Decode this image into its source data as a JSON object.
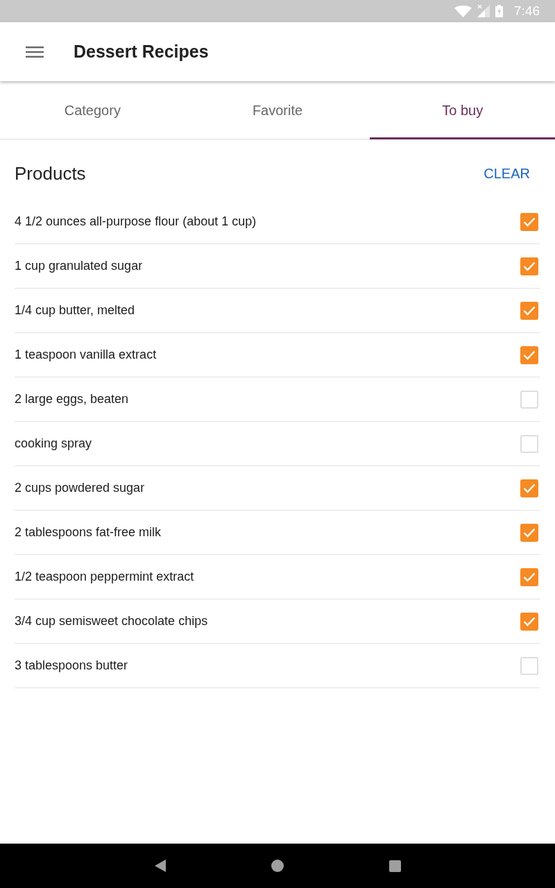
{
  "status_bar": {
    "time": "7:46"
  },
  "app_bar": {
    "title": "Dessert Recipes"
  },
  "tabs": [
    {
      "label": "Category",
      "selected": false
    },
    {
      "label": "Favorite",
      "selected": false
    },
    {
      "label": "To buy",
      "selected": true
    }
  ],
  "products": {
    "title": "Products",
    "clear_button": "CLEAR",
    "items": [
      {
        "name": "4 1/2 ounces all-purpose flour (about 1 cup)",
        "checked": true
      },
      {
        "name": "1 cup granulated sugar",
        "checked": true
      },
      {
        "name": "1/4 cup butter, melted",
        "checked": true
      },
      {
        "name": "1 teaspoon vanilla extract",
        "checked": true
      },
      {
        "name": "2 large eggs, beaten",
        "checked": false
      },
      {
        "name": "cooking spray",
        "checked": false
      },
      {
        "name": "2 cups powdered sugar",
        "checked": true
      },
      {
        "name": "2 tablespoons fat-free milk",
        "checked": true
      },
      {
        "name": "1/2 teaspoon peppermint extract",
        "checked": true
      },
      {
        "name": "3/4 cup semisweet chocolate chips",
        "checked": true
      },
      {
        "name": "3 tablespoons butter",
        "checked": false
      }
    ]
  }
}
